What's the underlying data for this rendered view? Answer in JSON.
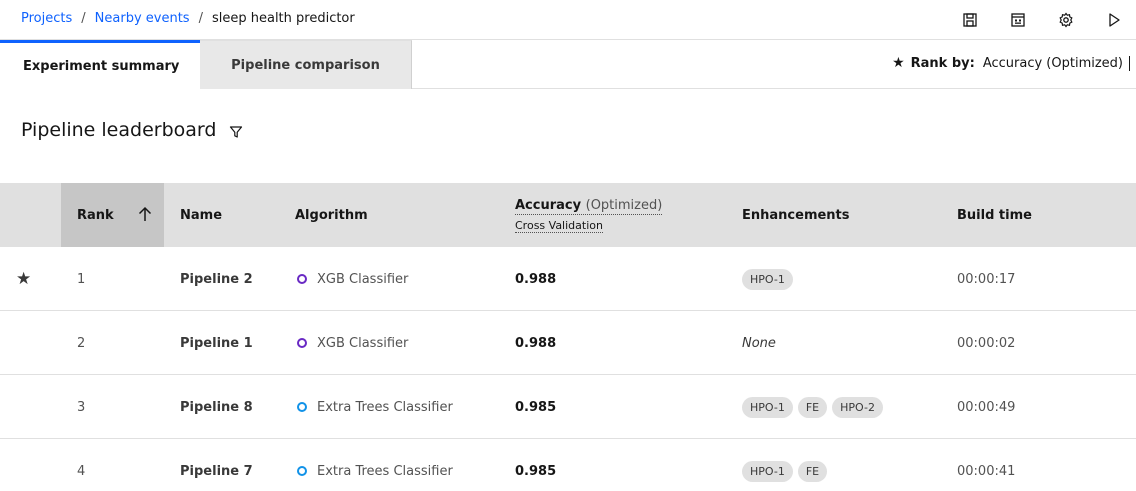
{
  "breadcrumb": {
    "items": [
      "Projects",
      "Nearby events"
    ],
    "separator": "/",
    "current": "sleep health predictor"
  },
  "toolbar": {
    "icons": [
      "save-icon",
      "notebook-icon",
      "settings-icon",
      "run-icon"
    ]
  },
  "tabs": [
    {
      "label": "Experiment summary",
      "active": true
    },
    {
      "label": "Pipeline comparison",
      "active": false
    }
  ],
  "rank_by": {
    "label": "Rank by:",
    "value": "Accuracy (Optimized)"
  },
  "section": {
    "title": "Pipeline leaderboard"
  },
  "table": {
    "headers": {
      "rank": "Rank",
      "name": "Name",
      "algorithm": "Algorithm",
      "accuracy": "Accuracy",
      "accuracy_suffix": "(Optimized)",
      "accuracy_sub": "Cross Validation",
      "enhancements": "Enhancements",
      "build_time": "Build time"
    },
    "rows": [
      {
        "starred": true,
        "rank": "1",
        "name": "Pipeline 2",
        "algorithm": "XGB Classifier",
        "algo_color": "#6929c4",
        "accuracy": "0.988",
        "enhancements": [
          "HPO-1"
        ],
        "enh_none": "",
        "build_time": "00:00:17"
      },
      {
        "starred": false,
        "rank": "2",
        "name": "Pipeline 1",
        "algorithm": "XGB Classifier",
        "algo_color": "#6929c4",
        "accuracy": "0.988",
        "enhancements": [],
        "enh_none": "None",
        "build_time": "00:00:02"
      },
      {
        "starred": false,
        "rank": "3",
        "name": "Pipeline 8",
        "algorithm": "Extra Trees Classifier",
        "algo_color": "#1192e8",
        "accuracy": "0.985",
        "enhancements": [
          "HPO-1",
          "FE",
          "HPO-2"
        ],
        "enh_none": "",
        "build_time": "00:00:49"
      },
      {
        "starred": false,
        "rank": "4",
        "name": "Pipeline 7",
        "algorithm": "Extra Trees Classifier",
        "algo_color": "#1192e8",
        "accuracy": "0.985",
        "enhancements": [
          "HPO-1",
          "FE"
        ],
        "enh_none": "",
        "build_time": "00:00:41"
      }
    ]
  },
  "colors": {
    "accent": "#0f62fe",
    "xgb": "#6929c4",
    "extra_trees": "#1192e8"
  }
}
